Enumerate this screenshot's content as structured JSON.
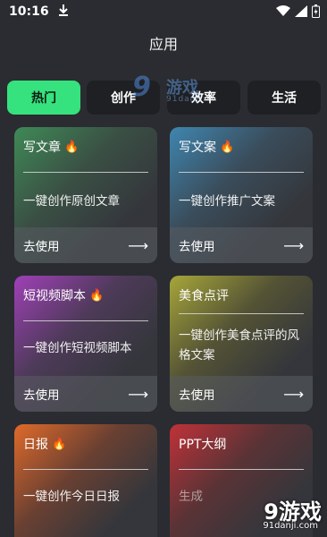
{
  "status": {
    "time": "10:16",
    "download_icon": "download-arrow-icon"
  },
  "header": {
    "title": "应用"
  },
  "tabs": [
    {
      "label": "热门",
      "active": true
    },
    {
      "label": "创作",
      "active": false
    },
    {
      "label": "效率",
      "active": false
    },
    {
      "label": "生活",
      "active": false
    }
  ],
  "watermark_top": {
    "num": "9",
    "text": "游戏",
    "sub": "91danji"
  },
  "cards": [
    {
      "title": "写文章",
      "fire": "🔥",
      "desc": "一键创作原创文章",
      "action": "去使用",
      "arrow": "⟶",
      "color": "#3f8a57"
    },
    {
      "title": "写文案",
      "fire": "🔥",
      "desc": "一键创作推广文案",
      "action": "去使用",
      "arrow": "⟶",
      "color": "#3f86b0"
    },
    {
      "title": "短视频脚本",
      "fire": "🔥",
      "desc": "一键创作短视频脚本",
      "action": "去使用",
      "arrow": "⟶",
      "color": "#a040b8"
    },
    {
      "title": "美食点评",
      "fire": "",
      "desc": "一键创作美食点评的风格文案",
      "action": "去使用",
      "arrow": "⟶",
      "color": "#a7a63a"
    },
    {
      "title": "日报",
      "fire": "🔥",
      "desc": "一键创作今日日报",
      "action": "",
      "arrow": "",
      "color": "#e06a2a"
    },
    {
      "title": "PPT大纲",
      "fire": "",
      "desc": "生成",
      "action": "",
      "arrow": "",
      "color": "#c03238"
    }
  ],
  "watermark_bottom": {
    "main": "9游戏",
    "sub": "91danji.com"
  },
  "colors": {
    "accent": "#35e27d",
    "background": "#2a2c31"
  }
}
